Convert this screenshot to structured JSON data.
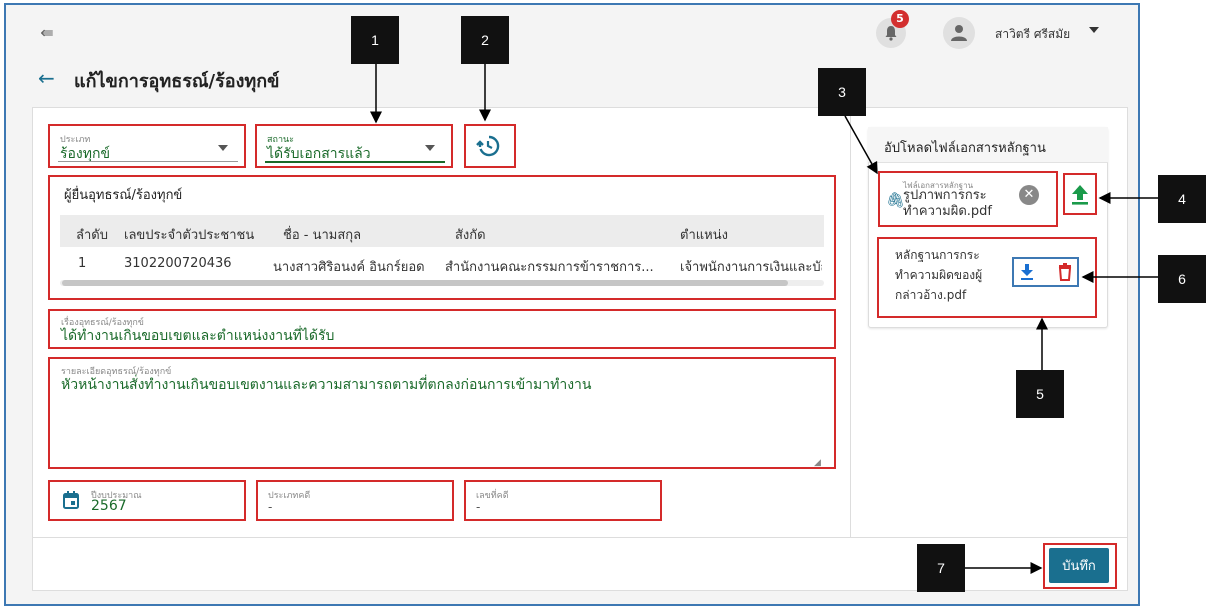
{
  "header": {
    "notifications_count": "5",
    "user_name": "สาวิตรี ศรีสมัย"
  },
  "page": {
    "title": "แก้ไขการอุทธรณ์/ร้องทุกข์"
  },
  "form": {
    "type": {
      "label": "ประเภท",
      "value": "ร้องทุกข์"
    },
    "status": {
      "label": "สถานะ",
      "value": "ได้รับเอกสารแล้ว"
    },
    "complainant": {
      "title": "ผู้ยื่นอุทธรณ์/ร้องทุกข์",
      "columns": [
        "ลำดับ",
        "เลขประจำตัวประชาชน",
        "ชื่อ - นามสกุล",
        "สังกัด",
        "ตำแหน่ง"
      ],
      "rows": [
        [
          "1",
          "3102200720436",
          "นางสาวศิริอนงค์ อินกร์ยอด",
          "สำนักงานคณะกรรมการข้าราชการ...",
          "เจ้าพนักงานการเงินและบัญ"
        ]
      ]
    },
    "subject": {
      "label": "เรื่องอุทธรณ์/ร้องทุกข์",
      "value": "ได้ทำงานเกินขอบเขตและตำแหน่งงานที่ได้รับ"
    },
    "details": {
      "label": "รายละเอียดอุทธรณ์/ร้องทุกข์",
      "value": "หัวหน้างานสั่งทำงานเกินขอบเขตงานและความสามารถตามที่ตกลงก่อนการเข้ามาทำงาน"
    },
    "budget_year": {
      "label": "ปีงบประมาณ",
      "value": "2567"
    },
    "case_type": {
      "label": "ประเภทคดี",
      "value": "-"
    },
    "case_number": {
      "label": "เลขที่คดี",
      "value": "-"
    },
    "save_label": "บันทึก"
  },
  "upload": {
    "title": "อัปโหลดไฟล์เอกสารหลักฐาน",
    "file_field_label": "ไฟล์เอกสารหลักฐาน",
    "file_field_value": "รูปภาพการกระทำความผิด.pdf",
    "evidence_file": "หลักฐานการกระทำความผิดของผู้กล่าวอ้าง.pdf"
  },
  "callouts": [
    "1",
    "2",
    "3",
    "4",
    "5",
    "6",
    "7"
  ],
  "colors": {
    "accent": "#1a6f8f",
    "annotation_red": "#d42a2a",
    "value_green": "#1a6a2a",
    "frame_blue": "#3d78b3"
  }
}
